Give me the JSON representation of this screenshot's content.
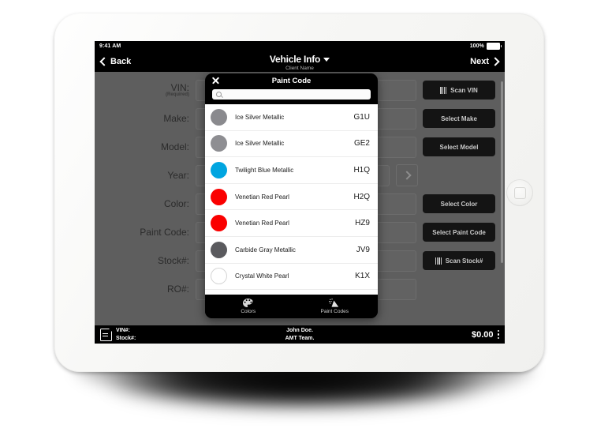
{
  "status_bar": {
    "time": "9:41 AM",
    "battery_percent": "100%"
  },
  "nav": {
    "back_label": "Back",
    "title": "Vehicle Info",
    "subtitle": "Client Name",
    "next_label": "Next"
  },
  "form": {
    "rows": [
      {
        "label": "VIN:",
        "required_note": "(Required)",
        "value": "",
        "button": "Scan VIN",
        "button_icon": "barcode-icon"
      },
      {
        "label": "Make:",
        "required_note": "",
        "value": "",
        "button": "Select Make",
        "button_icon": ""
      },
      {
        "label": "Model:",
        "required_note": "",
        "value": "",
        "button": "Select Model",
        "button_icon": ""
      },
      {
        "label": "Year:",
        "required_note": "",
        "value": "",
        "button": "",
        "button_icon": ""
      },
      {
        "label": "Color:",
        "required_note": "",
        "value": "",
        "button": "Select Color",
        "button_icon": ""
      },
      {
        "label": "Paint Code:",
        "required_note": "",
        "value": "",
        "button": "Select Paint Code",
        "button_icon": ""
      },
      {
        "label": "Stock#:",
        "required_note": "",
        "value": "",
        "button": "Scan Stock#",
        "button_icon": "barcode-icon"
      },
      {
        "label": "RO#:",
        "required_note": "",
        "value": "",
        "button": "",
        "button_icon": ""
      }
    ]
  },
  "bottom_bar": {
    "vin_label": "VIN#:",
    "stock_label": "Stock#:",
    "client_name": "John Doe.",
    "team_name": "AMT Team.",
    "total": "$0.00"
  },
  "modal": {
    "title": "Paint Code",
    "close_icon": "close-icon",
    "search": {
      "value": "",
      "placeholder": ""
    },
    "items": [
      {
        "name": "Ice Silver Metallic",
        "code": "G1U",
        "color": "#8a8a8e"
      },
      {
        "name": "Ice Silver Metallic",
        "code": "GE2",
        "color": "#8e8e92"
      },
      {
        "name": "Twilight Blue Metallic",
        "code": "H1Q",
        "color": "#00a5e0"
      },
      {
        "name": "Venetian Red Pearl",
        "code": "H2Q",
        "color": "#fa0000"
      },
      {
        "name": "Venetian Red Pearl",
        "code": "HZ9",
        "color": "#fa0000"
      },
      {
        "name": "Carbide Gray Metallic",
        "code": "JV9",
        "color": "#5a5a5e"
      },
      {
        "name": "Crystal White Pearl",
        "code": "K1X",
        "color": "#ffffff"
      }
    ],
    "tabs": [
      {
        "label": "Colors",
        "icon": "palette-icon",
        "active": false
      },
      {
        "label": "Paint Codes",
        "icon": "spray-icon",
        "active": true
      }
    ]
  }
}
